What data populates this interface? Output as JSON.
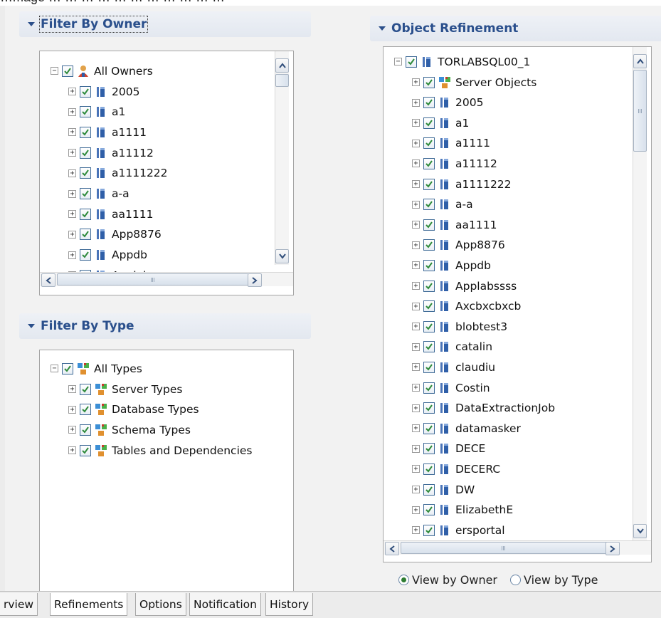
{
  "top_clip_text": "…mage … … … … … … … … … … …",
  "filter_by_owner": {
    "title": "Filter By Owner",
    "root": {
      "label": "All Owners",
      "icon": "owners-icon"
    },
    "items": [
      "2005",
      "a1",
      "a1111",
      "a11112",
      "a1111222",
      "a-a",
      "aa1111",
      "App8876",
      "Appdb",
      "Applabssss"
    ]
  },
  "filter_by_type": {
    "title": "Filter By Type",
    "root": {
      "label": "All Types",
      "icon": "type-group-icon"
    },
    "items": [
      "Server Types",
      "Database Types",
      "Schema Types",
      "Tables and Dependencies"
    ]
  },
  "object_refinement": {
    "title": "Object Refinement",
    "root": {
      "label": "TORLABSQL00_1",
      "icon": "server-icon"
    },
    "items": [
      {
        "label": "Server Objects",
        "icon": "type-group-icon"
      },
      {
        "label": "2005",
        "icon": "database-icon"
      },
      {
        "label": "a1",
        "icon": "database-icon"
      },
      {
        "label": "a1111",
        "icon": "database-icon"
      },
      {
        "label": "a11112",
        "icon": "database-icon"
      },
      {
        "label": "a1111222",
        "icon": "database-icon"
      },
      {
        "label": "a-a",
        "icon": "database-icon"
      },
      {
        "label": "aa1111",
        "icon": "database-icon"
      },
      {
        "label": "App8876",
        "icon": "database-icon"
      },
      {
        "label": "Appdb",
        "icon": "database-icon"
      },
      {
        "label": "Applabssss",
        "icon": "database-icon"
      },
      {
        "label": "Axcbxcbxcb",
        "icon": "database-icon"
      },
      {
        "label": "blobtest3",
        "icon": "database-icon"
      },
      {
        "label": "catalin",
        "icon": "database-icon"
      },
      {
        "label": "claudiu",
        "icon": "database-icon"
      },
      {
        "label": "Costin",
        "icon": "database-icon"
      },
      {
        "label": "DataExtractionJob",
        "icon": "database-icon"
      },
      {
        "label": "datamasker",
        "icon": "database-icon"
      },
      {
        "label": "DECE",
        "icon": "database-icon"
      },
      {
        "label": "DECERC",
        "icon": "database-icon"
      },
      {
        "label": "DW",
        "icon": "database-icon"
      },
      {
        "label": "ElizabethE",
        "icon": "database-icon"
      },
      {
        "label": "ersportal",
        "icon": "database-icon"
      }
    ]
  },
  "view_options": {
    "view_by_owner": "View by Owner",
    "view_by_type": "View by Type",
    "selected": "View by Owner"
  },
  "tabs": [
    "rview",
    "Refinements",
    "Options",
    "Notification",
    "History"
  ],
  "active_tab": "Refinements",
  "colors": {
    "header_text": "#2a4f8c",
    "checkbox_border": "#3f6b97",
    "radio_selected": "#2e7d32"
  }
}
